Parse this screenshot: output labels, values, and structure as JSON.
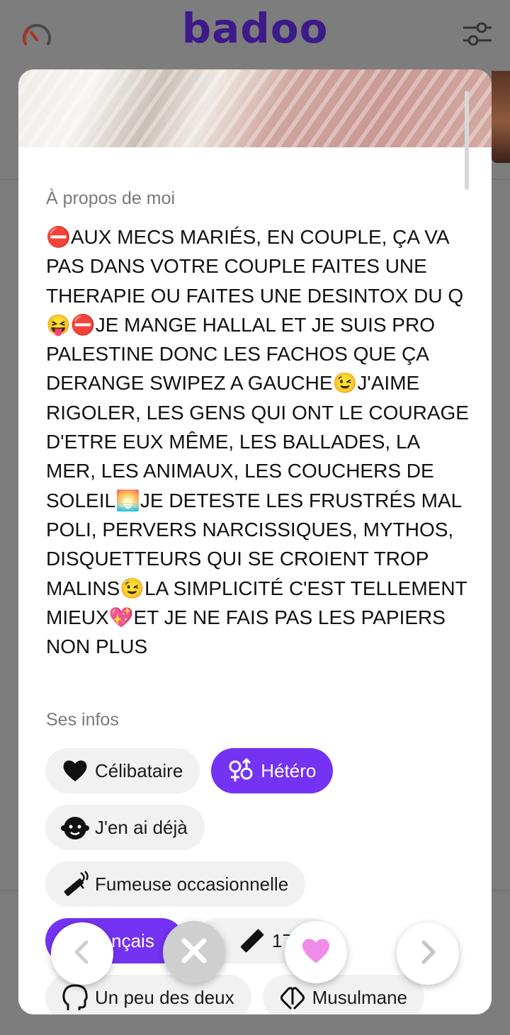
{
  "header": {
    "logo_text": "badoo",
    "speed_icon": "speedometer-icon",
    "filter_icon": "sliders-icon"
  },
  "profile": {
    "about_title": "À propos de moi",
    "about_text": "⛔AUX MECS MARIÉS, EN COUPLE, ÇA VA PAS DANS VOTRE COUPLE FAITES UNE THERAPIE OU FAITES UNE DESINTOX DU Q 😝⛔JE MANGE HALLAL ET JE SUIS PRO PALESTINE DONC LES FACHOS QUE ÇA DERANGE SWIPEZ A GAUCHE😉J'AIME RIGOLER, LES GENS QUI ONT LE COURAGE D'ETRE EUX MÊME, LES BALLADES, LA MER, LES ANIMAUX, LES COUCHERS DE SOLEIL🌅JE DETESTE LES FRUSTRÉS MAL POLI, PERVERS NARCISSIQUES, MYTHOS, DISQUETTEURS QUI SE CROIENT TROP MALINS😉LA SIMPLICITÉ C'EST TELLEMENT MIEUX💖ET JE NE FAIS PAS LES PAPIERS NON PLUS",
    "info_title": "Ses infos",
    "chips": [
      {
        "label": "Célibataire",
        "icon": "heart-icon",
        "highlight": false
      },
      {
        "label": "Hétéro",
        "icon": "gender-symbols-icon",
        "highlight": true
      },
      {
        "label": "J'en ai déjà",
        "icon": "baby-icon",
        "highlight": false
      },
      {
        "label": "Fumeuse occasionnelle",
        "icon": "cigarette-icon",
        "highlight": false
      },
      {
        "label": "Français",
        "visible_label": "rançais",
        "icon": "language-icon",
        "highlight": true
      },
      {
        "label": "170 c",
        "icon": "ruler-icon",
        "highlight": false
      },
      {
        "label": "Un peu des deux",
        "icon": "head-silhouette-icon",
        "highlight": false
      },
      {
        "label": "Musulmane",
        "icon": "praying-hands-icon",
        "highlight": false
      }
    ]
  },
  "actions": {
    "previous_icon": "chevron-left-icon",
    "dislike_icon": "close-icon",
    "like_icon": "heart-icon",
    "next_icon": "chevron-right-icon"
  },
  "colors": {
    "brand": "#3d1a8a",
    "accent": "#7433f2",
    "like": "#f08ce8",
    "speed": "#c0392b"
  }
}
